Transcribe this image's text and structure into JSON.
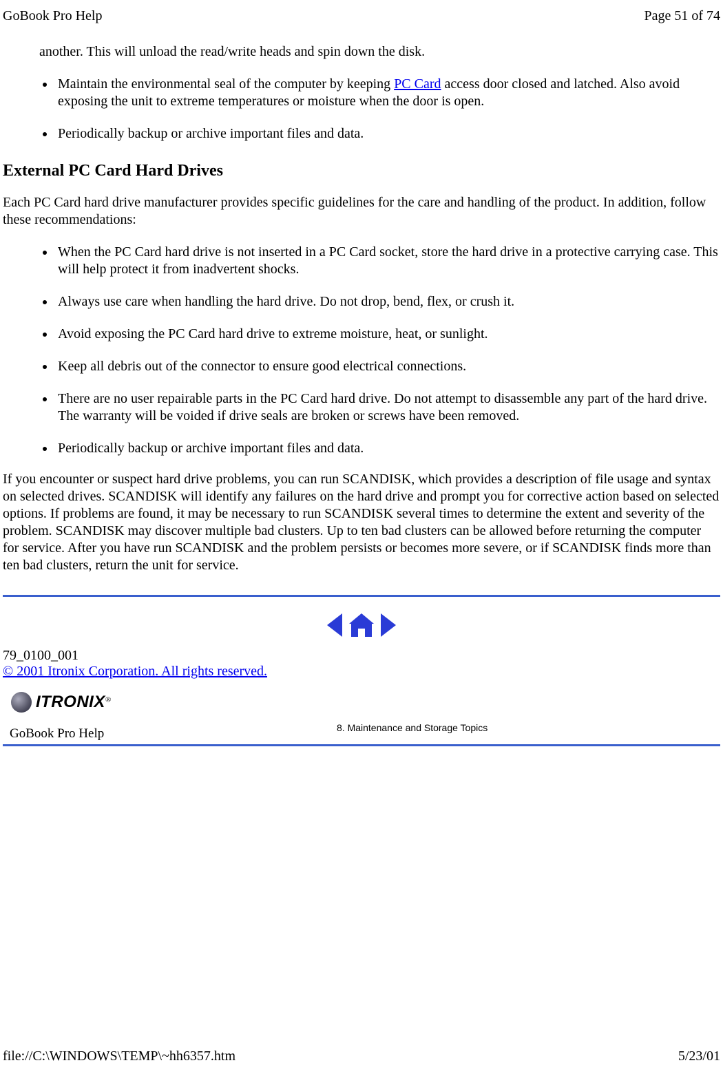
{
  "header": {
    "title": "GoBook Pro Help",
    "page_info": "Page 51 of 74"
  },
  "continued_paragraph": "another. This will unload the read/write heads and spin down the disk.",
  "top_bullets": [
    {
      "pre": "Maintain the environmental seal of the computer by keeping ",
      "link": "PC Card",
      "post": " access door closed and latched. Also avoid exposing the unit to extreme temperatures or moisture when the door is open."
    },
    {
      "pre": "Periodically backup or archive important files and data.",
      "link": "",
      "post": ""
    }
  ],
  "section_heading": "External PC Card Hard Drives",
  "intro_para": "Each PC Card hard drive manufacturer provides specific guidelines for the care and handling of the product. In addition, follow these recommendations:",
  "main_bullets": [
    "When the PC Card hard drive is not inserted in a PC Card socket, store the hard drive in a protective carrying case. This will help protect it from inadvertent shocks.",
    "Always use care when handling the hard drive. Do not drop, bend, flex, or crush it.",
    "Avoid exposing the PC Card hard drive to extreme moisture, heat, or sunlight.",
    "Keep all debris out of the connector to ensure good electrical connections.",
    "There are no user repairable parts in the PC Card hard drive. Do not attempt to disassemble any part of the hard drive. The warranty will be voided if drive seals are broken or screws have been removed.",
    "Periodically backup or archive important files and data."
  ],
  "scandisk_para": "If you encounter or suspect hard drive problems, you can run SCANDISK, which provides a description of file usage and syntax on selected drives.  SCANDISK will identify any failures on the hard drive and prompt you for corrective action based on selected options. If problems are found, it may be necessary to run SCANDISK several times to determine the extent and severity of the problem. SCANDISK may discover multiple bad clusters. Up to ten bad clusters can be allowed before returning the computer for service. After you have run SCANDISK and the problem persists or becomes more severe, or if SCANDISK finds more than ten bad clusters, return the unit for service.",
  "doc_id": "79_0100_001",
  "copyright": "© 2001 Itronix Corporation.  All rights reserved.",
  "logo_text": "ITRONIX",
  "footer_section": {
    "help_label": "GoBook Pro Help",
    "topic": "8. Maintenance and Storage Topics"
  },
  "footer": {
    "path": "file://C:\\WINDOWS\\TEMP\\~hh6357.htm",
    "date": "5/23/01"
  }
}
